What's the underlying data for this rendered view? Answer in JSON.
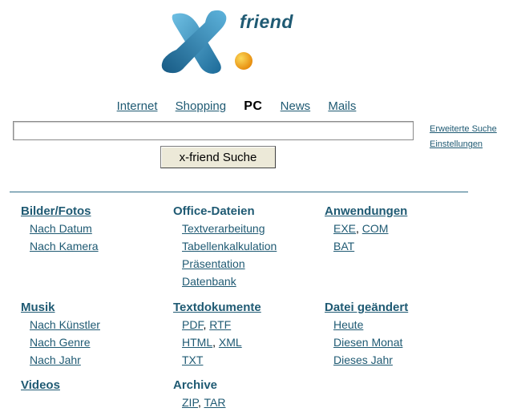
{
  "logo": {
    "text": "friend"
  },
  "tabs": [
    {
      "label": "Internet",
      "active": false
    },
    {
      "label": "Shopping",
      "active": false
    },
    {
      "label": "PC",
      "active": true
    },
    {
      "label": "News",
      "active": false
    },
    {
      "label": "Mails",
      "active": false
    }
  ],
  "search": {
    "value": "",
    "button_label": "x-friend Suche",
    "advanced_label": "Erweiterte Suche",
    "settings_label": "Einstellungen"
  },
  "categories": {
    "bilder": {
      "title": "Bilder/Fotos",
      "items": [
        "Nach Datum",
        "Nach Kamera"
      ]
    },
    "office": {
      "title": "Office-Dateien",
      "items": [
        "Textverarbeitung",
        "Tabellenkalkulation",
        "Präsentation",
        "Datenbank"
      ]
    },
    "anwendungen": {
      "title": "Anwendungen",
      "items": [
        "EXE",
        "COM",
        "BAT"
      ]
    },
    "musik": {
      "title": "Musik",
      "items": [
        "Nach Künstler",
        "Nach Genre",
        "Nach Jahr"
      ]
    },
    "textdok": {
      "title": "Textdokumente",
      "items": [
        "PDF",
        "RTF",
        "HTML",
        "XML",
        "TXT"
      ]
    },
    "geaendert": {
      "title": "Datei geändert",
      "items": [
        "Heute",
        "Diesen Monat",
        "Dieses Jahr"
      ]
    },
    "videos": {
      "title": "Videos"
    },
    "archive": {
      "title": "Archive",
      "items": [
        "ZIP",
        "TAR"
      ]
    }
  },
  "colors": {
    "link": "#1f5a73",
    "logo_blue": "#2a86b5",
    "logo_orange": "#f2a20c"
  },
  "icons": [
    "x-friend-logo"
  ]
}
